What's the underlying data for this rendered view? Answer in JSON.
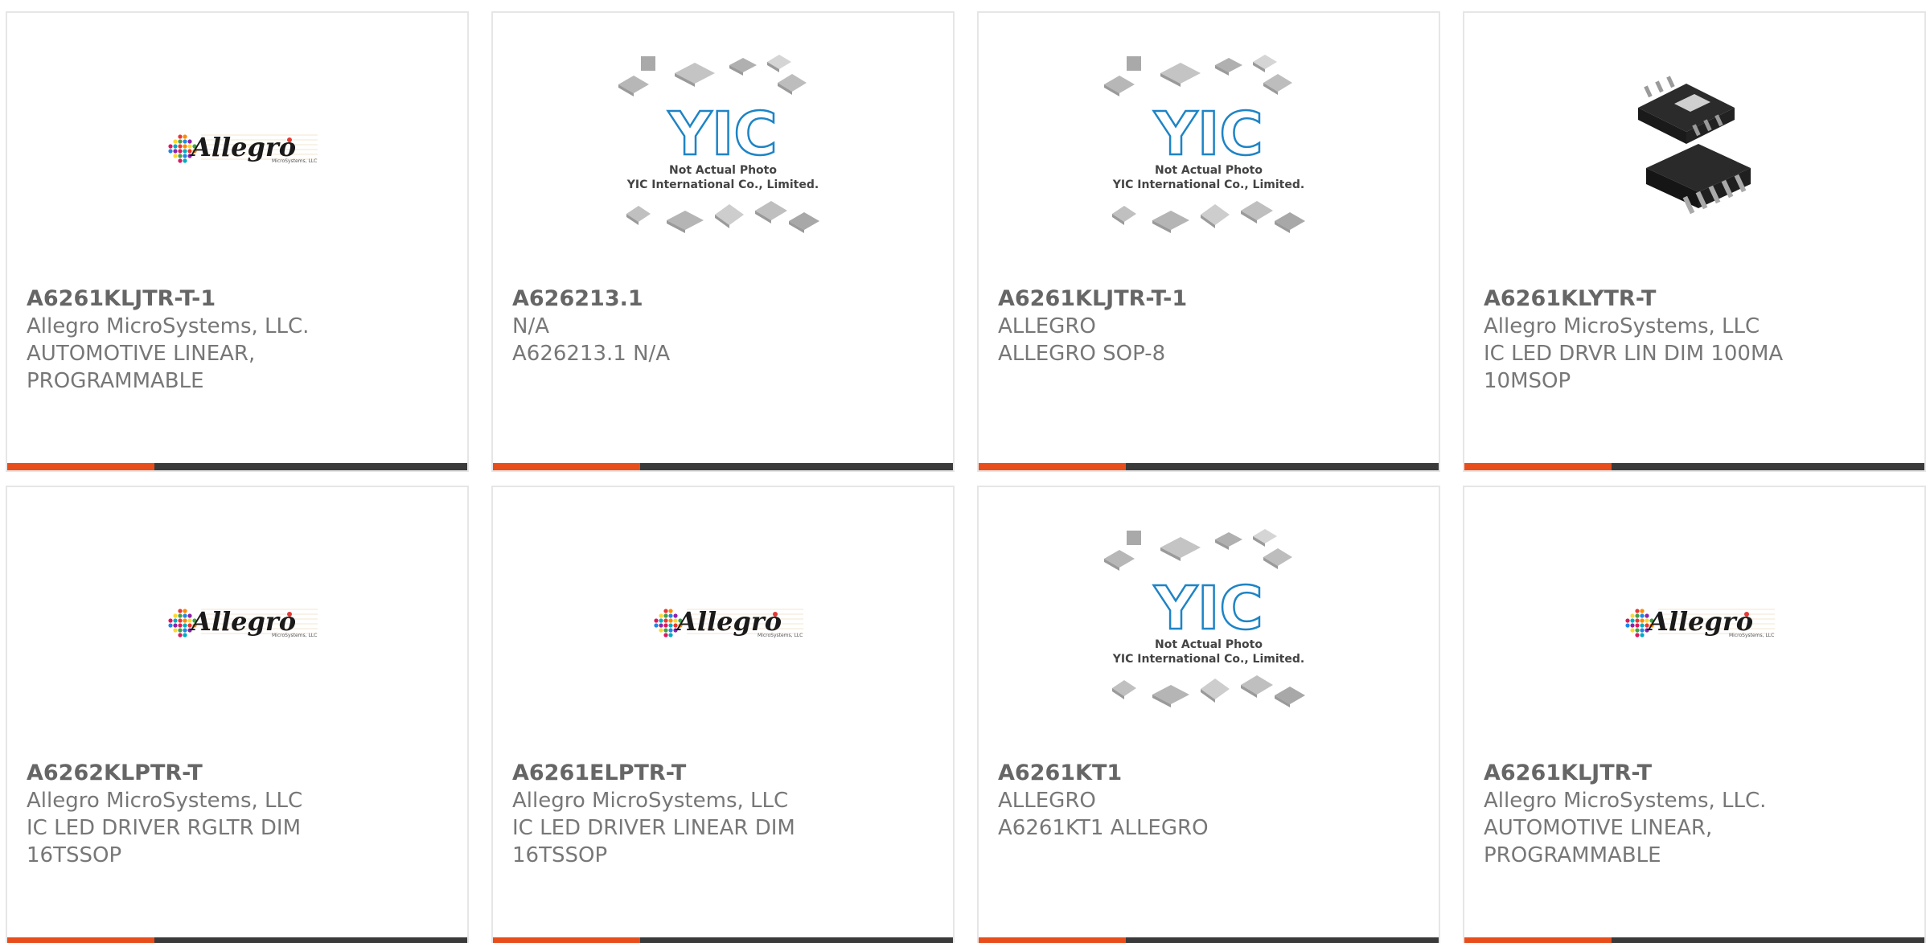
{
  "accent_color": "#e84e1b",
  "bar_color": "#3a3a3a",
  "yic_placeholder": {
    "logo_text": "YIC",
    "caption_line1": "Not Actual Photo",
    "caption_line2": "YIC International Co., Limited."
  },
  "allegro_logo": {
    "wordmark": "Allegro",
    "tagline": "MicroSystems, LLC"
  },
  "products": [
    {
      "part_number": "A6261KLJTR-T-1",
      "manufacturer": "Allegro MicroSystems, LLC.",
      "description_line1": "AUTOMOTIVE LINEAR,",
      "description_line2": "PROGRAMMABLE",
      "image": "allegro-logo"
    },
    {
      "part_number": "A626213.1",
      "manufacturer": "N/A",
      "description_line1": "A626213.1 N/A",
      "description_line2": "",
      "image": "yic-placeholder"
    },
    {
      "part_number": "A6261KLJTR-T-1",
      "manufacturer": "ALLEGRO",
      "description_line1": "ALLEGRO SOP-8",
      "description_line2": "",
      "image": "yic-placeholder"
    },
    {
      "part_number": "A6261KLYTR-T",
      "manufacturer": "Allegro MicroSystems, LLC",
      "description_line1": "IC LED DRVR LIN DIM 100MA",
      "description_line2": "10MSOP",
      "image": "msop-chip-photo"
    },
    {
      "part_number": "A6262KLPTR-T",
      "manufacturer": "Allegro MicroSystems, LLC",
      "description_line1": "IC LED DRIVER RGLTR DIM",
      "description_line2": "16TSSOP",
      "image": "allegro-logo"
    },
    {
      "part_number": "A6261ELPTR-T",
      "manufacturer": "Allegro MicroSystems, LLC",
      "description_line1": "IC LED DRIVER LINEAR DIM",
      "description_line2": "16TSSOP",
      "image": "allegro-logo"
    },
    {
      "part_number": "A6261KT1",
      "manufacturer": "ALLEGRO",
      "description_line1": "A6261KT1 ALLEGRO",
      "description_line2": "",
      "image": "yic-placeholder"
    },
    {
      "part_number": "A6261KLJTR-T",
      "manufacturer": "Allegro MicroSystems, LLC.",
      "description_line1": "AUTOMOTIVE LINEAR,",
      "description_line2": "PROGRAMMABLE",
      "image": "allegro-logo"
    }
  ]
}
